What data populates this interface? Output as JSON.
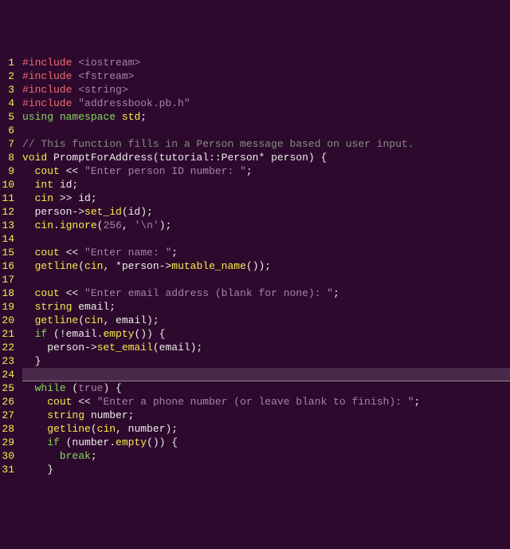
{
  "editor": {
    "language": "cpp",
    "current_line": 24,
    "lines": [
      {
        "n": 1,
        "segs": [
          {
            "c": "pp",
            "t": "#include "
          },
          {
            "c": "str",
            "t": "<iostream>"
          }
        ]
      },
      {
        "n": 2,
        "segs": [
          {
            "c": "pp",
            "t": "#include "
          },
          {
            "c": "str",
            "t": "<fstream>"
          }
        ]
      },
      {
        "n": 3,
        "segs": [
          {
            "c": "pp",
            "t": "#include "
          },
          {
            "c": "str",
            "t": "<string>"
          }
        ]
      },
      {
        "n": 4,
        "segs": [
          {
            "c": "pp",
            "t": "#include "
          },
          {
            "c": "str",
            "t": "\"addressbook.pb.h\""
          }
        ]
      },
      {
        "n": 5,
        "segs": [
          {
            "c": "kw",
            "t": "using"
          },
          {
            "c": "txt",
            "t": " "
          },
          {
            "c": "kw",
            "t": "namespace"
          },
          {
            "c": "txt",
            "t": " "
          },
          {
            "c": "type",
            "t": "std"
          },
          {
            "c": "txt",
            "t": ";"
          }
        ]
      },
      {
        "n": 6,
        "segs": [
          {
            "c": "txt",
            "t": ""
          }
        ]
      },
      {
        "n": 7,
        "segs": [
          {
            "c": "cmt",
            "t": "// This function fills in a Person message based on user input."
          }
        ]
      },
      {
        "n": 8,
        "segs": [
          {
            "c": "type",
            "t": "void"
          },
          {
            "c": "txt",
            "t": " PromptForAddress(tutorial::Person* person) {"
          }
        ]
      },
      {
        "n": 9,
        "segs": [
          {
            "c": "txt",
            "t": "  "
          },
          {
            "c": "type",
            "t": "cout"
          },
          {
            "c": "txt",
            "t": " << "
          },
          {
            "c": "str",
            "t": "\"Enter person ID number: \""
          },
          {
            "c": "txt",
            "t": ";"
          }
        ]
      },
      {
        "n": 10,
        "segs": [
          {
            "c": "txt",
            "t": "  "
          },
          {
            "c": "type",
            "t": "int"
          },
          {
            "c": "txt",
            "t": " id;"
          }
        ]
      },
      {
        "n": 11,
        "segs": [
          {
            "c": "txt",
            "t": "  "
          },
          {
            "c": "type",
            "t": "cin"
          },
          {
            "c": "txt",
            "t": " >> id;"
          }
        ]
      },
      {
        "n": 12,
        "segs": [
          {
            "c": "txt",
            "t": "  person->"
          },
          {
            "c": "type",
            "t": "set_id"
          },
          {
            "c": "txt",
            "t": "(id);"
          }
        ]
      },
      {
        "n": 13,
        "segs": [
          {
            "c": "txt",
            "t": "  "
          },
          {
            "c": "type",
            "t": "cin"
          },
          {
            "c": "txt",
            "t": "."
          },
          {
            "c": "type",
            "t": "ignore"
          },
          {
            "c": "txt",
            "t": "("
          },
          {
            "c": "num",
            "t": "256"
          },
          {
            "c": "txt",
            "t": ", "
          },
          {
            "c": "str",
            "t": "'\\n'"
          },
          {
            "c": "txt",
            "t": ");"
          }
        ]
      },
      {
        "n": 14,
        "segs": [
          {
            "c": "txt",
            "t": ""
          }
        ]
      },
      {
        "n": 15,
        "segs": [
          {
            "c": "txt",
            "t": "  "
          },
          {
            "c": "type",
            "t": "cout"
          },
          {
            "c": "txt",
            "t": " << "
          },
          {
            "c": "str",
            "t": "\"Enter name: \""
          },
          {
            "c": "txt",
            "t": ";"
          }
        ]
      },
      {
        "n": 16,
        "segs": [
          {
            "c": "txt",
            "t": "  "
          },
          {
            "c": "type",
            "t": "getline"
          },
          {
            "c": "txt",
            "t": "("
          },
          {
            "c": "type",
            "t": "cin"
          },
          {
            "c": "txt",
            "t": ", *person->"
          },
          {
            "c": "type",
            "t": "mutable_name"
          },
          {
            "c": "txt",
            "t": "());"
          }
        ]
      },
      {
        "n": 17,
        "segs": [
          {
            "c": "txt",
            "t": ""
          }
        ]
      },
      {
        "n": 18,
        "segs": [
          {
            "c": "txt",
            "t": "  "
          },
          {
            "c": "type",
            "t": "cout"
          },
          {
            "c": "txt",
            "t": " << "
          },
          {
            "c": "str",
            "t": "\"Enter email address (blank for none): \""
          },
          {
            "c": "txt",
            "t": ";"
          }
        ]
      },
      {
        "n": 19,
        "segs": [
          {
            "c": "txt",
            "t": "  "
          },
          {
            "c": "type",
            "t": "string"
          },
          {
            "c": "txt",
            "t": " email;"
          }
        ]
      },
      {
        "n": 20,
        "segs": [
          {
            "c": "txt",
            "t": "  "
          },
          {
            "c": "type",
            "t": "getline"
          },
          {
            "c": "txt",
            "t": "("
          },
          {
            "c": "type",
            "t": "cin"
          },
          {
            "c": "txt",
            "t": ", email);"
          }
        ]
      },
      {
        "n": 21,
        "segs": [
          {
            "c": "txt",
            "t": "  "
          },
          {
            "c": "kw",
            "t": "if"
          },
          {
            "c": "txt",
            "t": " (!email."
          },
          {
            "c": "type",
            "t": "empty"
          },
          {
            "c": "txt",
            "t": "()) {"
          }
        ]
      },
      {
        "n": 22,
        "segs": [
          {
            "c": "txt",
            "t": "    person->"
          },
          {
            "c": "type",
            "t": "set_email"
          },
          {
            "c": "txt",
            "t": "(email);"
          }
        ]
      },
      {
        "n": 23,
        "segs": [
          {
            "c": "txt",
            "t": "  }"
          }
        ]
      },
      {
        "n": 24,
        "segs": [
          {
            "c": "txt",
            "t": ""
          }
        ]
      },
      {
        "n": 25,
        "segs": [
          {
            "c": "txt",
            "t": "  "
          },
          {
            "c": "kw",
            "t": "while"
          },
          {
            "c": "txt",
            "t": " ("
          },
          {
            "c": "num",
            "t": "true"
          },
          {
            "c": "txt",
            "t": ") {"
          }
        ]
      },
      {
        "n": 26,
        "segs": [
          {
            "c": "txt",
            "t": "    "
          },
          {
            "c": "type",
            "t": "cout"
          },
          {
            "c": "txt",
            "t": " << "
          },
          {
            "c": "str",
            "t": "\"Enter a phone number (or leave blank to finish): \""
          },
          {
            "c": "txt",
            "t": ";"
          }
        ]
      },
      {
        "n": 27,
        "segs": [
          {
            "c": "txt",
            "t": "    "
          },
          {
            "c": "type",
            "t": "string"
          },
          {
            "c": "txt",
            "t": " number;"
          }
        ]
      },
      {
        "n": 28,
        "segs": [
          {
            "c": "txt",
            "t": "    "
          },
          {
            "c": "type",
            "t": "getline"
          },
          {
            "c": "txt",
            "t": "("
          },
          {
            "c": "type",
            "t": "cin"
          },
          {
            "c": "txt",
            "t": ", number);"
          }
        ]
      },
      {
        "n": 29,
        "segs": [
          {
            "c": "txt",
            "t": "    "
          },
          {
            "c": "kw",
            "t": "if"
          },
          {
            "c": "txt",
            "t": " (number."
          },
          {
            "c": "type",
            "t": "empty"
          },
          {
            "c": "txt",
            "t": "()) {"
          }
        ]
      },
      {
        "n": 30,
        "segs": [
          {
            "c": "txt",
            "t": "      "
          },
          {
            "c": "kw",
            "t": "break"
          },
          {
            "c": "txt",
            "t": ";"
          }
        ]
      },
      {
        "n": 31,
        "segs": [
          {
            "c": "txt",
            "t": "    }"
          }
        ]
      }
    ]
  }
}
